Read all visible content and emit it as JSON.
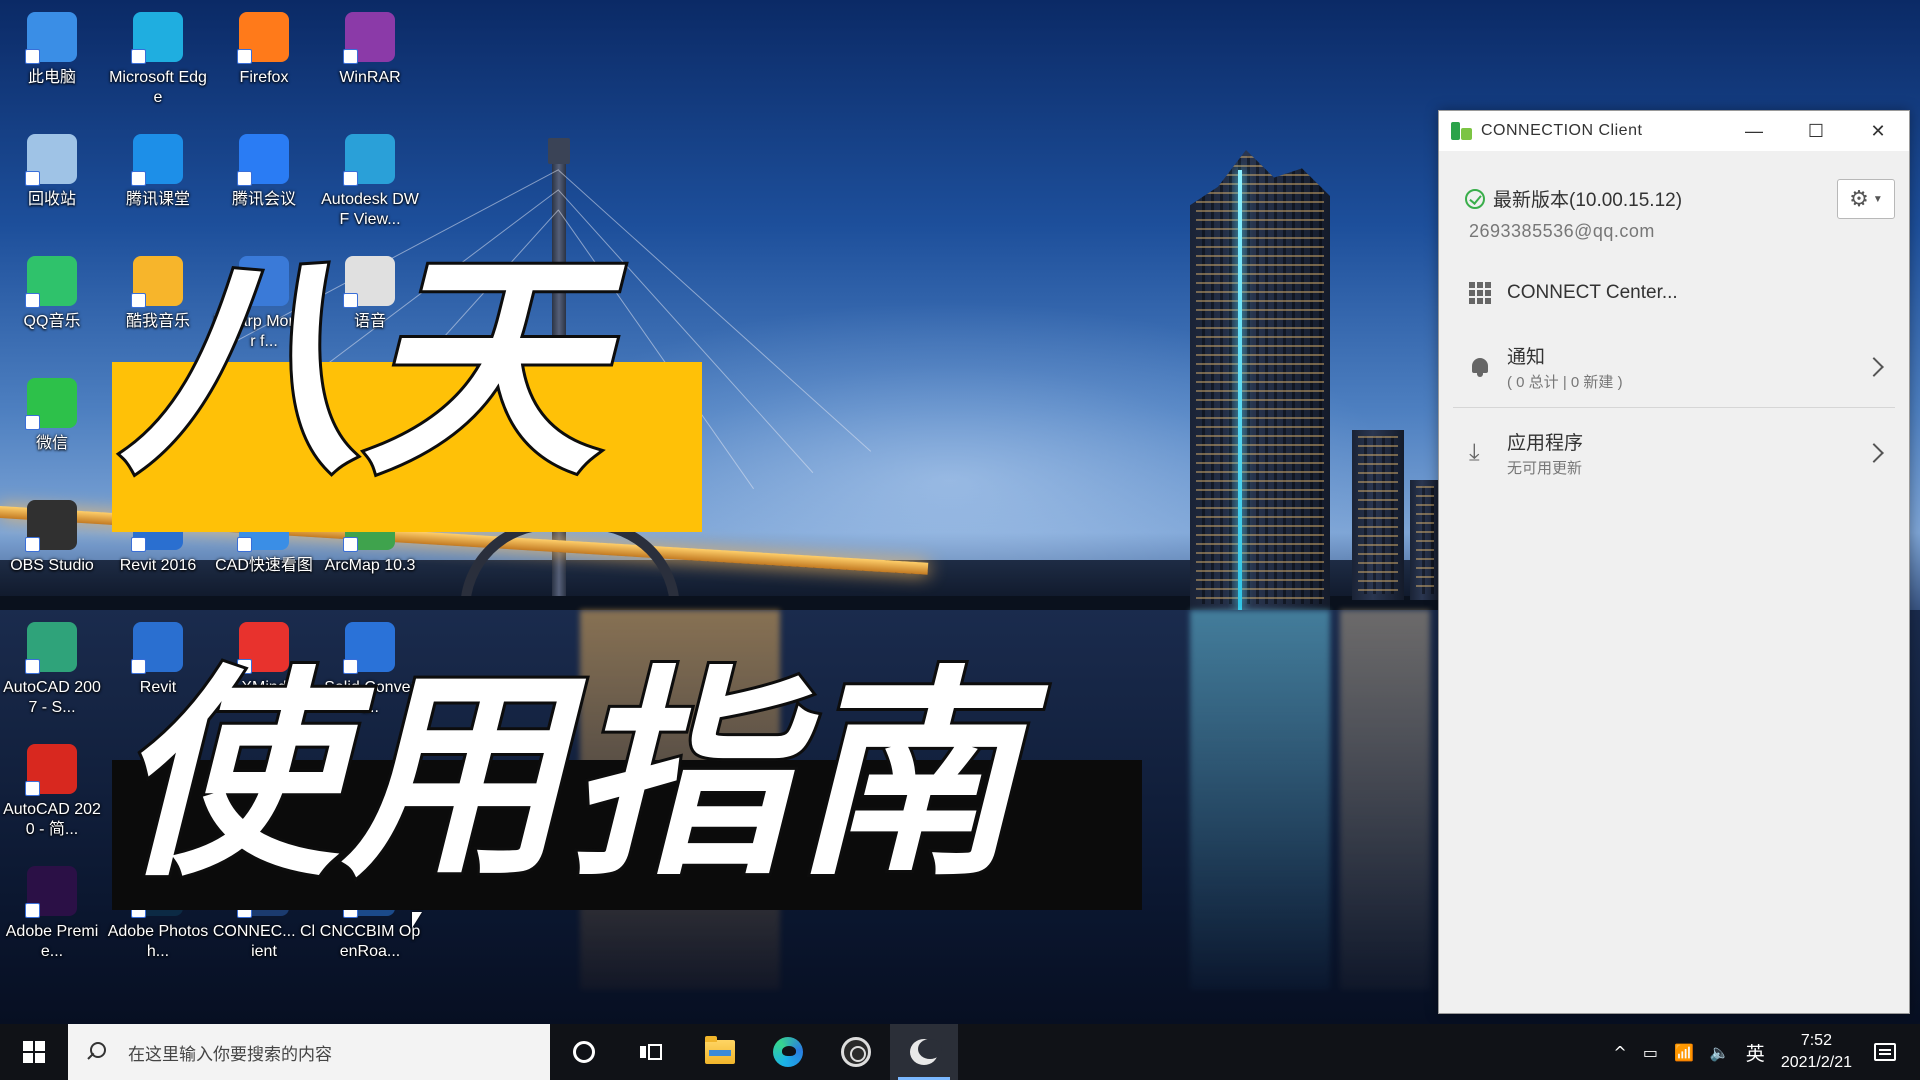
{
  "desktop": {
    "icons": [
      {
        "label": "此电脑",
        "icon": "computer-icon",
        "color": "#3a8ee6"
      },
      {
        "label": "Microsoft Edge",
        "icon": "edge-icon",
        "color": "#1faee0"
      },
      {
        "label": "Firefox",
        "icon": "firefox-icon",
        "color": "#ff7a1a"
      },
      {
        "label": "WinRAR",
        "icon": "winrar-icon",
        "color": "#8b3aa8"
      },
      {
        "label": "回收站",
        "icon": "recycle-bin-icon",
        "color": "#9fc3e6"
      },
      {
        "label": "腾讯课堂",
        "icon": "tencent-classroom-icon",
        "color": "#1d8fe8"
      },
      {
        "label": "腾讯会议",
        "icon": "tencent-meeting-icon",
        "color": "#2a7cf4"
      },
      {
        "label": "Autodesk DWF View...",
        "icon": "dwf-viewer-icon",
        "color": "#2aa0d8"
      },
      {
        "label": "QQ音乐",
        "icon": "qq-music-icon",
        "color": "#2fc26b"
      },
      {
        "label": "酷我音乐",
        "icon": "kuwo-music-icon",
        "color": "#f7b52b"
      },
      {
        "label": "ksharp Monitor f...",
        "icon": "monitor-icon",
        "color": "#3a7ad8"
      },
      {
        "label": "语音",
        "icon": "voice-icon",
        "color": "#e0e0e0"
      },
      {
        "label": "微信",
        "icon": "wechat-icon",
        "color": "#2dc14a"
      },
      {
        "label": "OBS Studio",
        "icon": "obs-icon",
        "color": "#303030"
      },
      {
        "label": "Revit 2016",
        "icon": "revit-icon",
        "color": "#2a6fd0"
      },
      {
        "label": "CAD快速看图",
        "icon": "cad-viewer-icon",
        "color": "#3a8ee6"
      },
      {
        "label": "ArcMap 10.3",
        "icon": "arcmap-icon",
        "color": "#3fa34d"
      },
      {
        "label": "AutoCAD 2007 - S...",
        "icon": "autocad-2007-icon",
        "color": "#2fa37a"
      },
      {
        "label": "Revit",
        "icon": "revit-icon",
        "color": "#2a6fd0"
      },
      {
        "label": "XMind",
        "icon": "xmind-icon",
        "color": "#e8322d"
      },
      {
        "label": "Solid Convert...",
        "icon": "solid-converter-icon",
        "color": "#2a72d8"
      },
      {
        "label": "AutoCAD 2020 - 简...",
        "icon": "autocad-2020-icon",
        "color": "#d8281f"
      },
      {
        "label": "Adobe Premie...",
        "icon": "premiere-icon",
        "color": "#2b1046"
      },
      {
        "label": "Adobe Photosh...",
        "icon": "photoshop-icon",
        "color": "#0c2a44"
      },
      {
        "label": "CONNEC... Client",
        "icon": "connection-client-icon",
        "color": "#1b3b6f"
      },
      {
        "label": "CNCCBIM OpenRoa...",
        "icon": "cnccbim-icon",
        "color": "#1b4a8a"
      }
    ]
  },
  "overlay": {
    "title_line1": "八天",
    "title_line2": "使用指南",
    "line1_bar_color": "#ffc107",
    "line2_bar_color": "#0b0b0b"
  },
  "cc_window": {
    "title": "CONNECTION Client",
    "minimize": "—",
    "maximize": "☐",
    "close": "✕",
    "version": "最新版本(10.00.15.12)",
    "email": "2693385536@qq.com",
    "connect_center": "CONNECT Center...",
    "notifications": {
      "title": "通知",
      "sub": "( 0 总计 | 0 新建 )"
    },
    "apps": {
      "title": "应用程序",
      "sub": "无可用更新"
    }
  },
  "taskbar": {
    "search_placeholder": "在这里输入你要搜索的内容",
    "tray": {
      "ime": "英",
      "volume": "🔈",
      "network": "📶",
      "battery": "▭",
      "chevron": "^"
    },
    "time": "7:52",
    "date": "2021/2/21"
  }
}
